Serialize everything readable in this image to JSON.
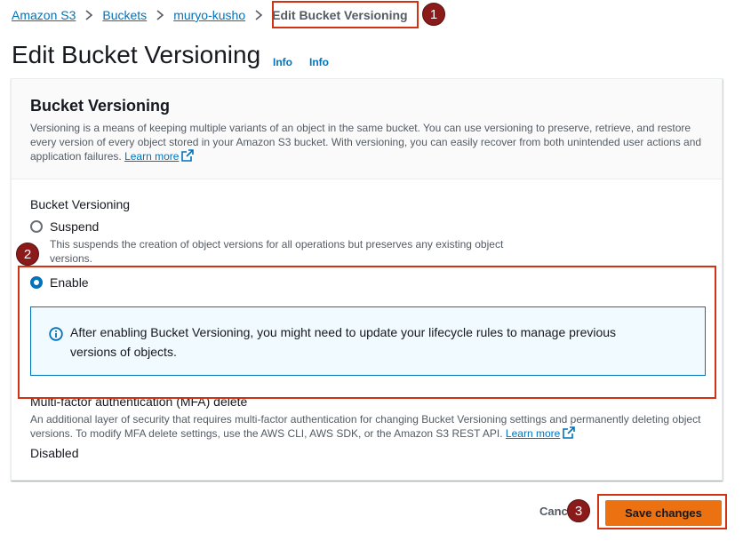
{
  "breadcrumb": {
    "items": [
      "Amazon S3",
      "Buckets",
      "muryo-kusho"
    ],
    "current": "Edit Bucket Versioning"
  },
  "page": {
    "title": "Edit Bucket Versioning",
    "info_links": [
      "Info",
      "Info"
    ]
  },
  "panel": {
    "title": "Bucket Versioning",
    "description": "Versioning is a means of keeping multiple variants of an object in the same bucket. You can use versioning to preserve, retrieve, and restore every version of every object stored in your Amazon S3 bucket. With versioning, you can easily recover from both unintended user actions and application failures.",
    "learn_more": "Learn more"
  },
  "versioning": {
    "label": "Bucket Versioning",
    "options": [
      {
        "label": "Suspend",
        "description": "This suspends the creation of object versions for all operations but preserves any existing object versions.",
        "selected": false
      },
      {
        "label": "Enable",
        "selected": true
      }
    ],
    "alert": "After enabling Bucket Versioning, you might need to update your lifecycle rules to manage previous versions of objects."
  },
  "mfa": {
    "title": "Multi-factor authentication (MFA) delete",
    "description": "An additional layer of security that requires multi-factor authentication for changing Bucket Versioning settings and permanently deleting object versions. To modify MFA delete settings, use the AWS CLI, AWS SDK, or the Amazon S3 REST API.",
    "learn_more": "Learn more",
    "value": "Disabled"
  },
  "actions": {
    "cancel": "Cancel",
    "save": "Save changes"
  },
  "annotations": {
    "steps": [
      "1",
      "2",
      "3"
    ],
    "color": "#d13212"
  },
  "colors": {
    "link": "#0073bb",
    "primary_button": "#ec7211",
    "badge": "#8b1a1a"
  }
}
